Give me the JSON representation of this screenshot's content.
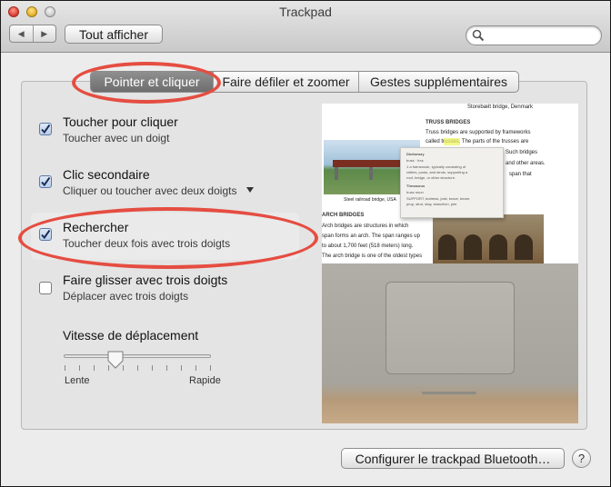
{
  "window": {
    "title": "Trackpad"
  },
  "toolbar": {
    "back_label": "◀",
    "forward_label": "▶",
    "show_all_label": "Tout afficher"
  },
  "search": {
    "placeholder": "",
    "value": ""
  },
  "tabs": [
    {
      "label": "Pointer et cliquer",
      "active": true
    },
    {
      "label": "Faire défiler et zoomer",
      "active": false
    },
    {
      "label": "Gestes supplémentaires",
      "active": false
    }
  ],
  "options": [
    {
      "title": "Toucher pour cliquer",
      "subtitle": "Toucher avec un doigt",
      "checked": true
    },
    {
      "title": "Clic secondaire",
      "subtitle": "Cliquer ou toucher avec deux doigts",
      "checked": true,
      "has_dropdown": true
    },
    {
      "title": "Rechercher",
      "subtitle": "Toucher deux fois avec trois doigts",
      "checked": true,
      "highlighted": true
    },
    {
      "title": "Faire glisser avec trois doigts",
      "subtitle": "Déplacer avec trois doigts",
      "checked": false
    }
  ],
  "speed": {
    "label": "Vitesse de déplacement",
    "min_label": "Lente",
    "max_label": "Rapide",
    "value": 0.35
  },
  "preview": {
    "doc_header": "Storebælt bridge, Denmark",
    "caption1": "Steel railroad bridge, USA",
    "truss_title": "TRUSS BRIDGES",
    "truss_lines": [
      "Truss bridges are supported by frameworks",
      "called trusses. The parts of the trusses are",
      "Such bridges",
      "and other areas.",
      "span that"
    ],
    "arch_title": "ARCH BRIDGES",
    "arch_lines": [
      "Arch bridges are structures in which",
      "span forms an arch. The span ranges up",
      "to about 1,700 feet (518 meters) long.",
      "The arch bridge is one of the oldest types"
    ],
    "popup_lines": [
      "Dictionary",
      "truss · trʌs",
      "1 a framework, typically consisting of",
      "rafters, posts, and struts, supporting a",
      "roof, bridge, or other structure.",
      "Thesaurus",
      "truss noun",
      "SUPPORT, buttress, joist, brace, beam,",
      "prop, strut, stay, stanchion, pier"
    ]
  },
  "bluetooth_button_label": "Configurer le trackpad Bluetooth…",
  "help_label": "?",
  "annotation_color": "#e54d41"
}
